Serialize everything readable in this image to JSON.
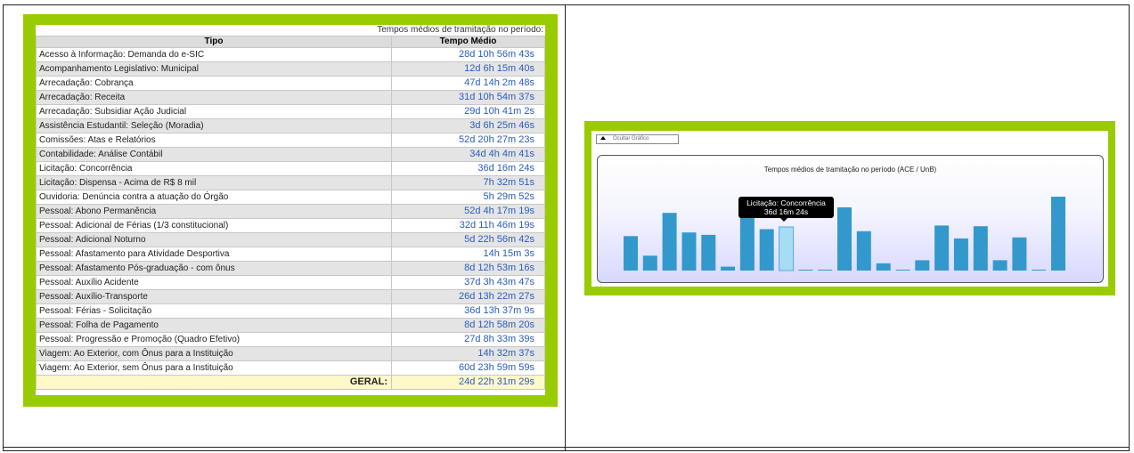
{
  "table": {
    "caption": "Tempos médios de tramitação no período:",
    "headers": {
      "tipo": "Tipo",
      "tempo": "Tempo Médio"
    },
    "rows": [
      {
        "tipo": "Acesso à Informação: Demanda do e-SIC",
        "tempo": "28d 10h 56m 43s"
      },
      {
        "tipo": "Acompanhamento Legislativo: Municipal",
        "tempo": "12d 6h 15m 40s"
      },
      {
        "tipo": "Arrecadação: Cobrança",
        "tempo": "47d 14h 2m 48s"
      },
      {
        "tipo": "Arrecadação: Receita",
        "tempo": "31d 10h 54m 37s"
      },
      {
        "tipo": "Arrecadação: Subsidiar Ação Judicial",
        "tempo": "29d 10h 41m 2s"
      },
      {
        "tipo": "Assistência Estudantil: Seleção (Moradia)",
        "tempo": "3d 6h 25m 46s"
      },
      {
        "tipo": "Comissões: Atas e Relatórios",
        "tempo": "52d 20h 27m 23s"
      },
      {
        "tipo": "Contabilidade: Análise Contábil",
        "tempo": "34d 4h 4m 41s"
      },
      {
        "tipo": "Licitação: Concorrência",
        "tempo": "36d 16m 24s"
      },
      {
        "tipo": "Licitação: Dispensa - Acima de R$ 8 mil",
        "tempo": "7h 32m 51s"
      },
      {
        "tipo": "Ouvidoria: Denúncia contra a atuação do Órgão",
        "tempo": "5h 29m 52s"
      },
      {
        "tipo": "Pessoal: Abono Permanência",
        "tempo": "52d 4h 17m 19s"
      },
      {
        "tipo": "Pessoal: Adicional de Férias (1/3 constitucional)",
        "tempo": "32d 11h 46m 19s"
      },
      {
        "tipo": "Pessoal: Adicional Noturno",
        "tempo": "5d 22h 56m 42s"
      },
      {
        "tipo": "Pessoal: Afastamento para Atividade Desportiva",
        "tempo": "14h 15m 3s"
      },
      {
        "tipo": "Pessoal: Afastamento Pós-graduação - com ônus",
        "tempo": "8d 12h 53m 16s"
      },
      {
        "tipo": "Pessoal: Auxílio Acidente",
        "tempo": "37d 3h 43m 47s"
      },
      {
        "tipo": "Pessoal: Auxílio-Transporte",
        "tempo": "26d 13h 22m 27s"
      },
      {
        "tipo": "Pessoal: Férias - Solicitação",
        "tempo": "36d 13h 37m 9s"
      },
      {
        "tipo": "Pessoal: Folha de Pagamento",
        "tempo": "8d 12h 58m 20s"
      },
      {
        "tipo": "Pessoal: Progressão e Promoção (Quadro Efetivo)",
        "tempo": "27d 8h 33m 39s"
      },
      {
        "tipo": "Viagem: Ao Exterior, com Ônus para a Instituição",
        "tempo": "14h 32m 37s"
      },
      {
        "tipo": "Viagem: Ao Exterior, sem Ônus para a Instituição",
        "tempo": "60d 23h 59m 59s"
      }
    ],
    "total": {
      "label": "GERAL:",
      "tempo": "24d 22h 31m 29s"
    }
  },
  "chart_panel": {
    "toggle_label": "Ocultar Gráfico",
    "tooltip": {
      "label": "Licitação: Concorrência",
      "value": "36d 16m 24s"
    }
  },
  "chart_data": {
    "type": "bar",
    "title": "Tempos médios de tramitação no período (ACE / UnB)",
    "categories": [
      "Acesso à Informação: Demanda do e-SIC",
      "Acompanhamento Legislativo: Municipal",
      "Arrecadação: Cobrança",
      "Arrecadação: Receita",
      "Arrecadação: Subsidiar Ação Judicial",
      "Assistência Estudantil: Seleção (Moradia)",
      "Comissões: Atas e Relatórios",
      "Contabilidade: Análise Contábil",
      "Licitação: Concorrência",
      "Licitação: Dispensa - Acima de R$ 8 mil",
      "Ouvidoria: Denúncia contra a atuação do Órgão",
      "Pessoal: Abono Permanência",
      "Pessoal: Adicional de Férias (1/3 constitucional)",
      "Pessoal: Adicional Noturno",
      "Pessoal: Afastamento para Atividade Desportiva",
      "Pessoal: Afastamento Pós-graduação - com ônus",
      "Pessoal: Auxílio Acidente",
      "Pessoal: Auxílio-Transporte",
      "Pessoal: Férias - Solicitação",
      "Pessoal: Folha de Pagamento",
      "Pessoal: Progressão e Promoção (Quadro Efetivo)",
      "Viagem: Ao Exterior, com Ônus para a Instituição",
      "Viagem: Ao Exterior, sem Ônus para a Instituição"
    ],
    "values": [
      28.46,
      12.26,
      47.59,
      31.45,
      29.45,
      3.27,
      52.85,
      34.17,
      36.01,
      0.31,
      0.23,
      52.18,
      32.49,
      5.96,
      0.59,
      8.54,
      37.16,
      26.56,
      36.57,
      8.54,
      27.36,
      0.61,
      61.0
    ],
    "highlighted": "Licitação: Concorrência",
    "colors": {
      "bar": "#3399cc",
      "bar_highlight": "#a8dcf4",
      "bar_highlight_border": "#55aadd"
    },
    "grid": false,
    "legend": "none"
  }
}
